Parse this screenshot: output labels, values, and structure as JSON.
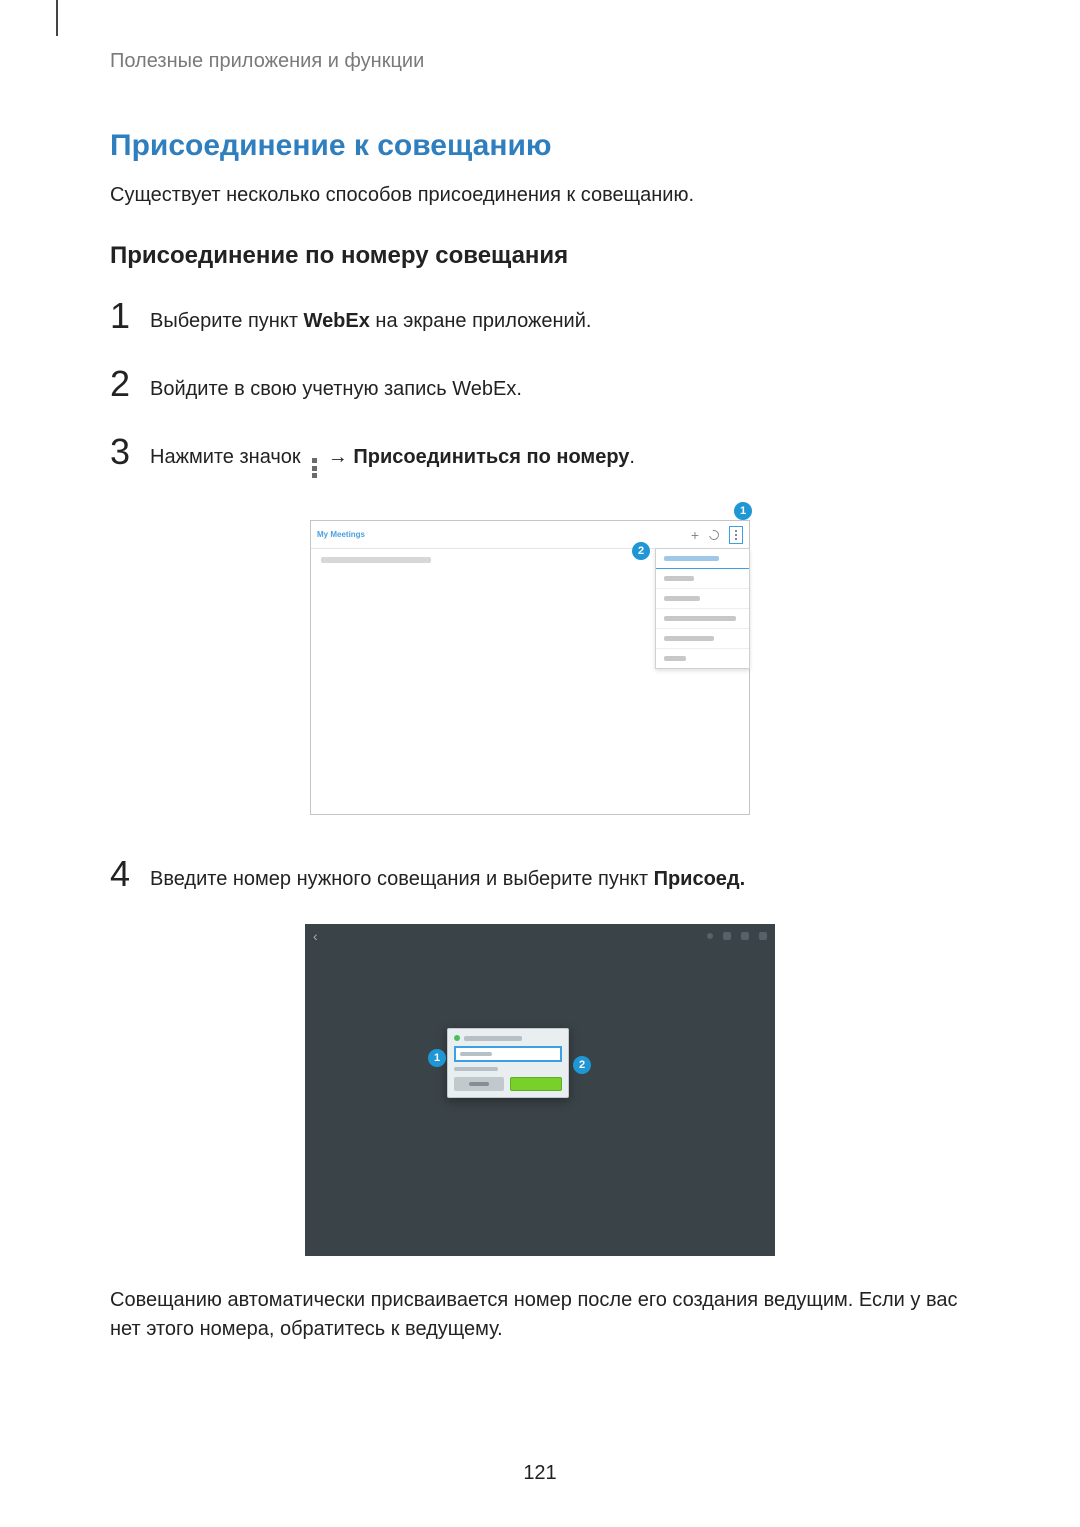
{
  "breadcrumb": "Полезные приложения и функции",
  "h1": "Присоединение к совещанию",
  "intro": "Существует несколько способов присоединения к совещанию.",
  "h2": "Присоединение по номеру совещания",
  "steps": {
    "s1": {
      "num": "1",
      "pre": "Выберите пункт ",
      "bold": "WebEx",
      "post": " на экране приложений."
    },
    "s2": {
      "num": "2",
      "text": "Войдите в свою учетную запись WebEx."
    },
    "s3": {
      "num": "3",
      "pre": "Нажмите значок ",
      "arrow": " → ",
      "bold": "Присоединиться по номеру",
      "post": "."
    },
    "s4": {
      "num": "4",
      "pre": "Введите номер нужного совещания и выберите пункт ",
      "bold": "Присоед."
    }
  },
  "footer": "Совещанию автоматически присваивается номер после его создания ведущим. Если у вас нет этого номера, обратитесь к ведущему.",
  "page_num": "121",
  "shot1": {
    "title": "My Meetings",
    "callout1": "1",
    "callout2": "2"
  },
  "shot2": {
    "callout1": "1",
    "callout2": "2"
  }
}
